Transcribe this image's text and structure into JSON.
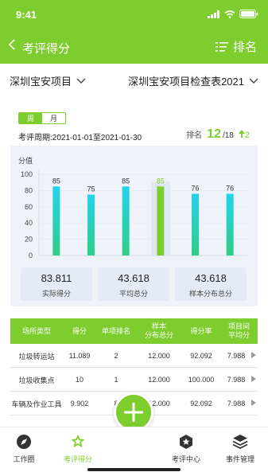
{
  "status": {
    "time": "9:41"
  },
  "nav": {
    "title": "考评得分",
    "rank_label": "排名"
  },
  "selectors": {
    "project": "深圳宝安项目",
    "checklist": "深圳宝安项目检查表2021"
  },
  "period": {
    "tabs": [
      {
        "label": "周",
        "active": true
      },
      {
        "label": "月",
        "active": false
      }
    ],
    "range_text": "考评周期:2021-01-01至2021-01-30",
    "rank_prefix": "排名",
    "rank_value": "12",
    "rank_total": "/18",
    "rank_change": "2"
  },
  "chart_data": {
    "type": "bar",
    "ylabel": "分值",
    "yticks": [
      "0",
      "20",
      "40",
      "60",
      "80",
      "100"
    ],
    "ylim": [
      0,
      100
    ],
    "values": [
      85,
      75,
      85,
      85,
      76,
      76
    ],
    "labels": [
      "85",
      "75",
      "85",
      "85",
      "76",
      "76"
    ],
    "highlight_index": 3,
    "colors": [
      "#26d4e6",
      "#26d4e6",
      "#26c79a",
      "#7ccd2d",
      "#26d4e6",
      "#26d4e6"
    ],
    "highlight_color": "#7ccd2d"
  },
  "stats": [
    {
      "value": "83.811",
      "label": "实际得分"
    },
    {
      "value": "43.618",
      "label": "平均总分"
    },
    {
      "value": "43.618",
      "label": "样本分布总分"
    }
  ],
  "table": {
    "headers": [
      "场所类型",
      "得分",
      "单项排名",
      "样本\n分布总分",
      "得分率",
      "项目间\n平均分"
    ],
    "rows": [
      [
        "垃圾转运站",
        "11.089",
        "2",
        "12.000",
        "92.092",
        "7.988"
      ],
      [
        "垃圾收集点",
        "10",
        "1",
        "12.000",
        "100.000",
        "7.988"
      ],
      [
        "车辆及作业工具",
        "9.902",
        "8",
        "12.000",
        "92.092",
        "7.988"
      ]
    ]
  },
  "tabbar": {
    "items": [
      {
        "label": "工作圈",
        "icon": "compass-icon"
      },
      {
        "label": "考评得分",
        "icon": "star-badge-icon",
        "active": true
      },
      {
        "label": "考评中心",
        "icon": "star-hexagon-icon"
      },
      {
        "label": "事件管理",
        "icon": "layers-icon"
      }
    ],
    "fab_icon": "plus-icon"
  }
}
